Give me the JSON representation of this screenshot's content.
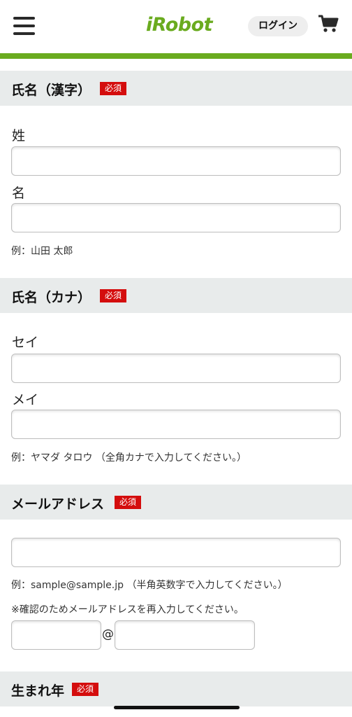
{
  "header": {
    "logo": "iRobot",
    "login_label": "ログイン"
  },
  "colors": {
    "brand_green": "#6aab1f",
    "required_red": "#d40d0d",
    "section_bg": "#e8ebeb"
  },
  "required_badge": "必須",
  "section_name_kanji": {
    "title": "氏名（漢字）",
    "last_label": "姓",
    "first_label": "名",
    "last_value": "",
    "first_value": "",
    "example": "例：山田 太郎"
  },
  "section_name_kana": {
    "title": "氏名（カナ）",
    "last_label": "セイ",
    "first_label": "メイ",
    "last_value": "",
    "first_value": "",
    "example": "例：ヤマダ タロウ （全角カナで入力してください。）"
  },
  "section_email": {
    "title": "メールアドレス",
    "value": "",
    "example": "例：sample@sample.jp （半角英数字で入力してください。）",
    "confirm_note": "※確認のためメールアドレスを再入力してください。",
    "confirm_local_value": "",
    "at_sign": "@",
    "confirm_domain_value": ""
  },
  "section_birth_year": {
    "title": "生まれ年"
  }
}
